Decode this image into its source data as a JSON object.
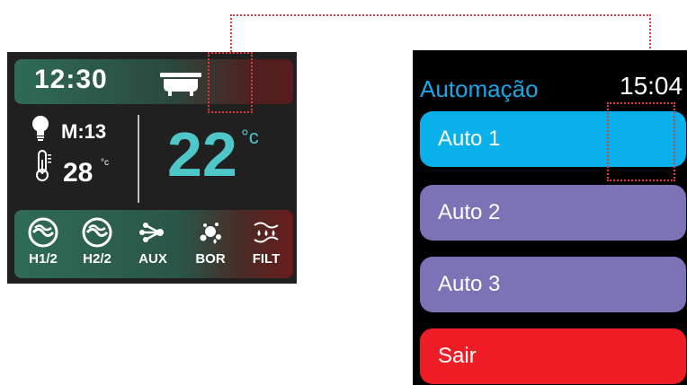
{
  "control_panel": {
    "clock": "12:30",
    "mode_label": "M:13",
    "water_temp": "28",
    "water_temp_unit": "°c",
    "set_temp": "22",
    "set_temp_unit": "°c",
    "buttons": [
      {
        "label": "H1/2",
        "icon": "jet-swirl-icon"
      },
      {
        "label": "H2/2",
        "icon": "jet-swirl-icon"
      },
      {
        "label": "AUX",
        "icon": "branch-icon"
      },
      {
        "label": "BOR",
        "icon": "bubbles-icon"
      },
      {
        "label": "FILT",
        "icon": "filter-drops-icon"
      }
    ]
  },
  "watch": {
    "title": "Automação",
    "time": "15:04",
    "items": [
      {
        "label": "Auto 1",
        "color": "#0ab0ea"
      },
      {
        "label": "Auto 2",
        "color": "#7b73b6"
      },
      {
        "label": "Auto 3",
        "color": "#7b73b6"
      },
      {
        "label": "Sair",
        "color": "#ee1c25"
      }
    ]
  },
  "colors": {
    "accent_teal": "#4fc7c9",
    "title_blue": "#1aa6e6",
    "highlight_red": "#e0393e"
  }
}
